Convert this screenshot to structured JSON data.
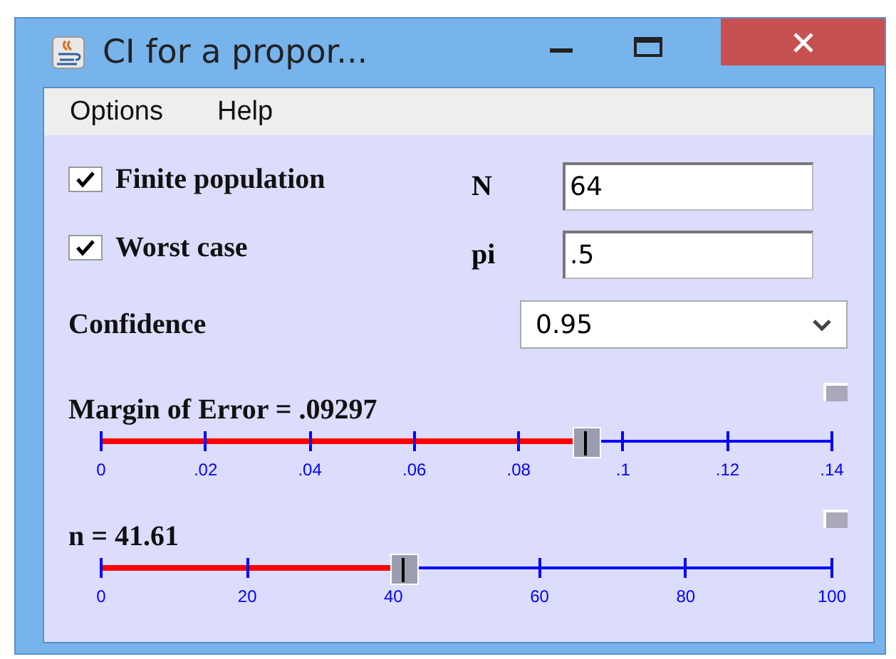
{
  "window": {
    "title": "CI for a propor..."
  },
  "menu": [
    "Options",
    "Help"
  ],
  "options": [
    {
      "label": "Finite population",
      "checked": true,
      "field_label": "N",
      "value": "64"
    },
    {
      "label": "Worst case",
      "checked": true,
      "field_label": "pi",
      "value": ".5"
    }
  ],
  "confidence": {
    "label": "Confidence",
    "value": "0.95"
  },
  "sliders": [
    {
      "title": "Margin of Error = .09297",
      "level": 0.664,
      "ticks": [
        "0",
        ".02",
        ".04",
        ".06",
        ".08",
        ".1",
        ".12",
        ".14"
      ]
    },
    {
      "title": "n = 41.61",
      "level": 0.416,
      "ticks": [
        "0",
        "20",
        "40",
        "60",
        "80",
        "100"
      ]
    }
  ]
}
